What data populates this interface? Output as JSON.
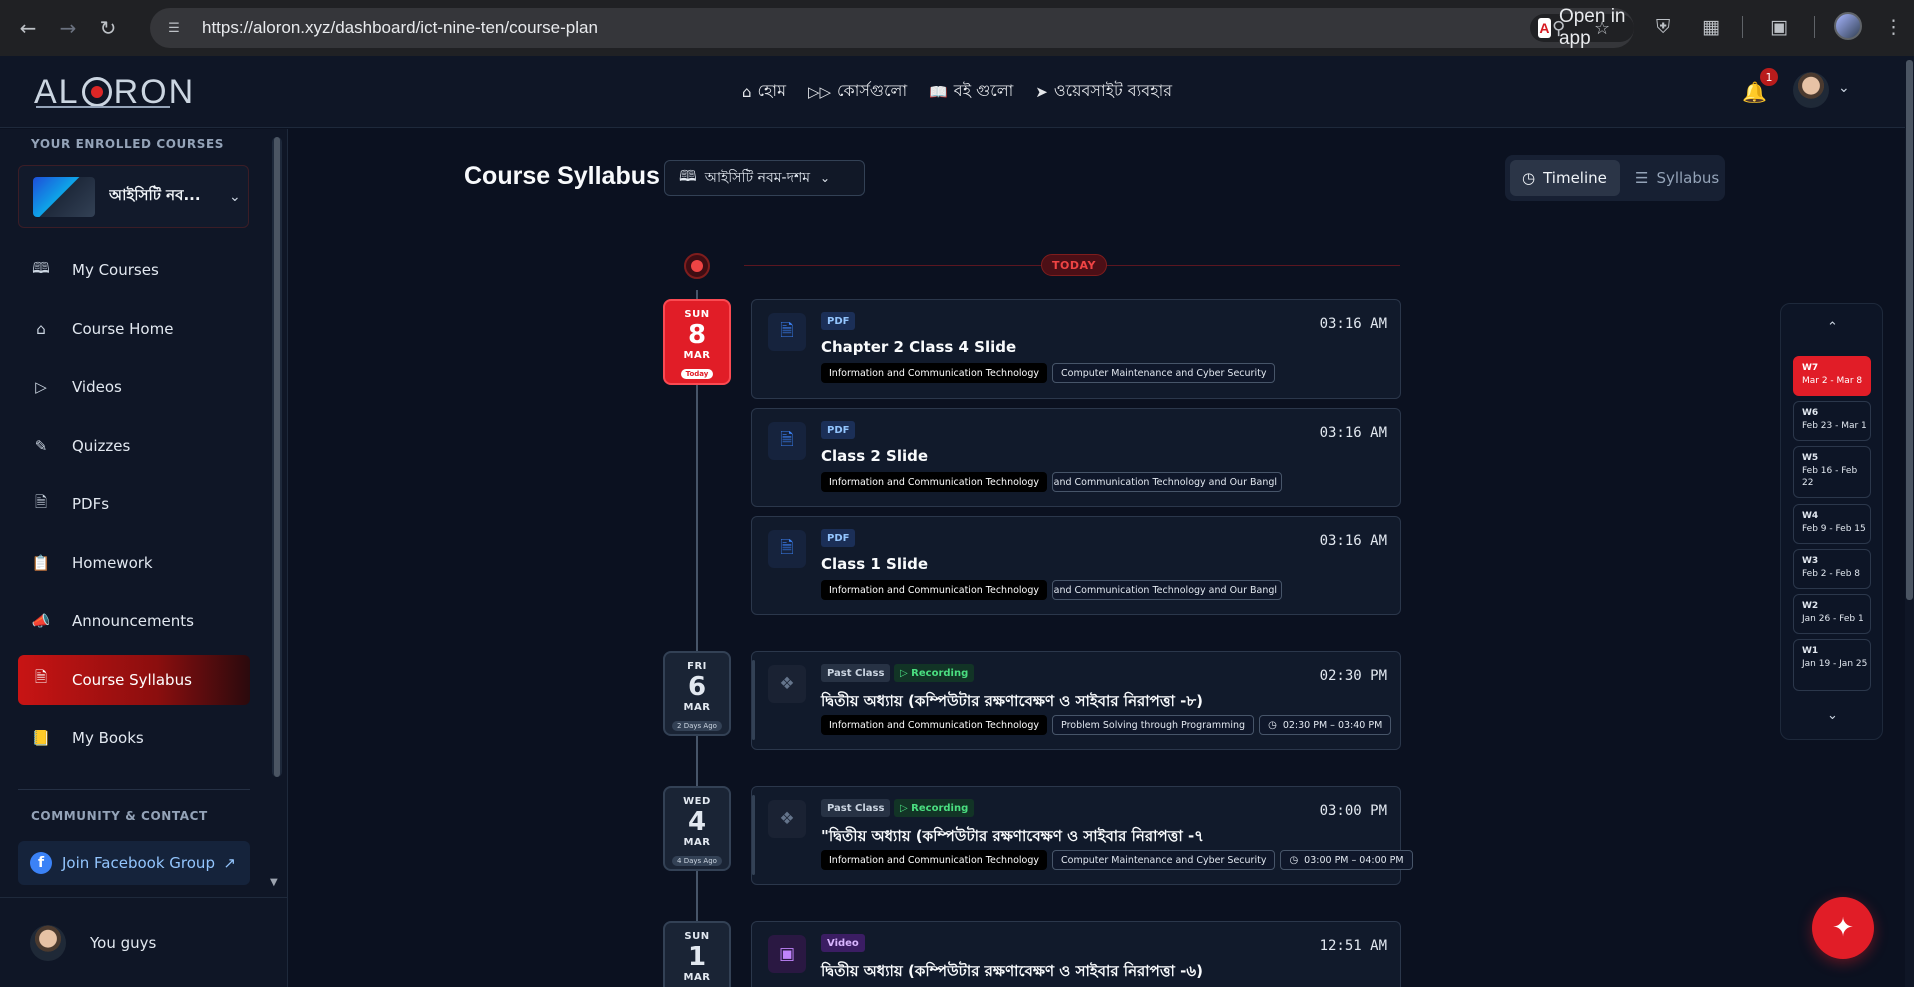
{
  "browser": {
    "url": "https://aloron.xyz/dashboard/ict-nine-ten/course-plan",
    "open_in_app": "Open in app"
  },
  "header": {
    "brand": "ALORON",
    "nav": [
      {
        "label": "হোম",
        "icon": "home-icon"
      },
      {
        "label": "কোর্সগুলো",
        "icon": "fast-forward-icon"
      },
      {
        "label": "বই গুলো",
        "icon": "book-icon"
      },
      {
        "label": "ওয়েবসাইট ব্যবহার",
        "icon": "send-icon"
      }
    ],
    "notification_count": "1"
  },
  "sidebar": {
    "enrolled_heading": "YOUR ENROLLED COURSES",
    "course_selector": "আইসিটি নব...",
    "items": [
      {
        "label": "My Courses",
        "icon": "book-open-icon"
      },
      {
        "label": "Course Home",
        "icon": "home-icon"
      },
      {
        "label": "Videos",
        "icon": "play-circle-icon"
      },
      {
        "label": "Quizzes",
        "icon": "pen-icon"
      },
      {
        "label": "PDFs",
        "icon": "file-icon"
      },
      {
        "label": "Homework",
        "icon": "clipboard-icon"
      },
      {
        "label": "Announcements",
        "icon": "megaphone-icon"
      },
      {
        "label": "Course Syllabus",
        "icon": "file-text-icon",
        "active": true
      },
      {
        "label": "My Books",
        "icon": "book-icon"
      }
    ],
    "community_heading": "COMMUNITY & CONTACT",
    "facebook_button": "Join Facebook Group",
    "user_name": "You guys"
  },
  "main": {
    "title": "Course Syllabus",
    "course_dropdown": "আইসিটি নবম-দশম",
    "view_toggle": {
      "timeline": "Timeline",
      "syllabus": "Syllabus",
      "selected": "Timeline"
    },
    "today_label": "TODAY"
  },
  "timeline": {
    "dates": [
      {
        "dow": "SUN",
        "day": "8",
        "mon": "MAR",
        "rel": "Today"
      },
      {
        "dow": "FRI",
        "day": "6",
        "mon": "MAR",
        "rel": "2 Days Ago"
      },
      {
        "dow": "WED",
        "day": "4",
        "mon": "MAR",
        "rel": "4 Days Ago"
      },
      {
        "dow": "SUN",
        "day": "1",
        "mon": "MAR",
        "rel": ""
      }
    ],
    "cards": [
      {
        "type": "PDF",
        "time": "03:16 AM",
        "title": "Chapter 2 Class 4 Slide",
        "tag1": "Information and Communication Technology",
        "tag2": "Computer Maintenance and Cyber Security"
      },
      {
        "type": "PDF",
        "time": "03:16 AM",
        "title": "Class 2 Slide",
        "tag1": "Information and Communication Technology",
        "tag2": "Information and Communication Technology and Our Bangl"
      },
      {
        "type": "PDF",
        "time": "03:16 AM",
        "title": "Class 1 Slide",
        "tag1": "Information and Communication Technology",
        "tag2": "Information and Communication Technology and Our Bangl"
      },
      {
        "type": "Past Class",
        "status": "Recording",
        "time": "02:30 PM",
        "title": "দ্বিতীয় অধ্যায় (কম্পিউটার রক্ষণাবেক্ষণ ও সাইবার নিরাপত্তা -৮)",
        "tag1": "Information and Communication Technology",
        "tag2": "Problem Solving through Programming",
        "range": "02:30 PM – 03:40 PM"
      },
      {
        "type": "Past Class",
        "status": "Recording",
        "time": "03:00 PM",
        "title": "\"দ্বিতীয় অধ্যায় (কম্পিউটার রক্ষণাবেক্ষণ ও সাইবার নিরাপত্তা -৭",
        "tag1": "Information and Communication Technology",
        "tag2": "Computer Maintenance and Cyber Security",
        "range": "03:00 PM – 04:00 PM"
      },
      {
        "type": "Video",
        "time": "12:51 AM",
        "title": "দ্বিতীয় অধ্যায় (কম্পিউটার রক্ষণাবেক্ষণ ও সাইবার নিরাপত্তা -৬)"
      }
    ]
  },
  "weeks": [
    {
      "w": "W7",
      "range": "Mar 2 - Mar 8",
      "active": true
    },
    {
      "w": "W6",
      "range": "Feb 23 - Mar 1"
    },
    {
      "w": "W5",
      "range": "Feb 16 - Feb 22"
    },
    {
      "w": "W4",
      "range": "Feb 9 - Feb 15"
    },
    {
      "w": "W3",
      "range": "Feb 2 - Feb 8"
    },
    {
      "w": "W2",
      "range": "Jan 26 - Feb 1"
    },
    {
      "w": "W1",
      "range": "Jan 19 - Jan 25"
    }
  ],
  "colors": {
    "accent": "#e11d27",
    "background": "#0b1120",
    "card": "#111a2b",
    "recording": "#4ade80"
  }
}
